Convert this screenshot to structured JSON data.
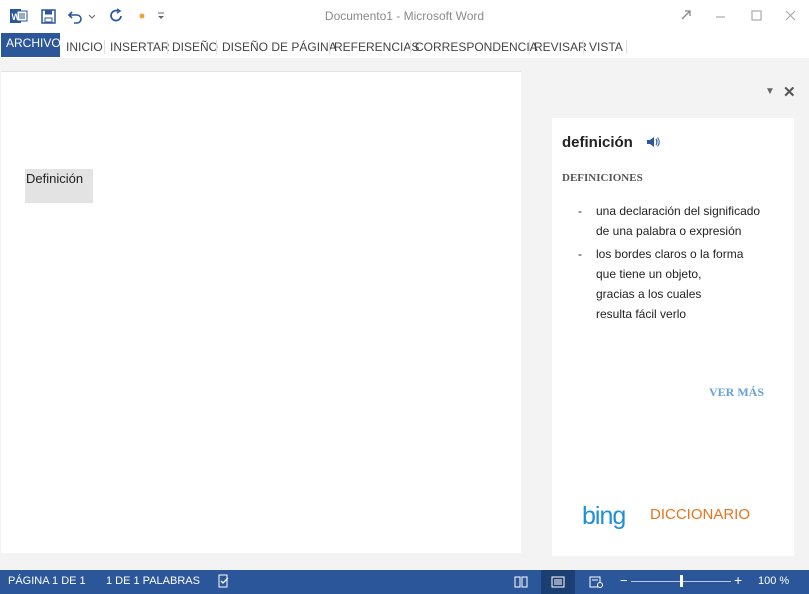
{
  "window": {
    "title": "Documento1 - Microsoft Word"
  },
  "ribbon": {
    "tabs": [
      "ARCHIVO",
      "INICIO",
      "INSERTAR",
      "DISEÑO",
      "DISEÑO DE PÁGINA",
      "REFERENCIAS",
      "CORRESPONDENCIA",
      "REVISAR",
      "VISTA"
    ]
  },
  "document": {
    "selected_text": "Definición"
  },
  "pane": {
    "word": "definición",
    "section_heading": "DEFINICIONES",
    "definitions": [
      "una declaración del significado\nde una palabra o expresión",
      "los bordes claros o la forma\nque tiene un objeto,\ngracias a los cuales\nresulta fácil verlo"
    ],
    "bullet": "-",
    "more_link": "VER MÁS",
    "brand_logo": "bing",
    "brand_label": "DICCIONARIO"
  },
  "statusbar": {
    "page": "PÁGINA 1 DE 1",
    "words": "1 DE 1 PALABRAS",
    "zoom": "100 %",
    "zoom_minus": "−",
    "zoom_plus": "+",
    "zoom_level": 0.5
  },
  "colors": {
    "accent": "#2b579a",
    "bing_blue": "#1f8fd6",
    "dict_orange": "#e8731d",
    "link_blue": "#6a9fd4"
  }
}
